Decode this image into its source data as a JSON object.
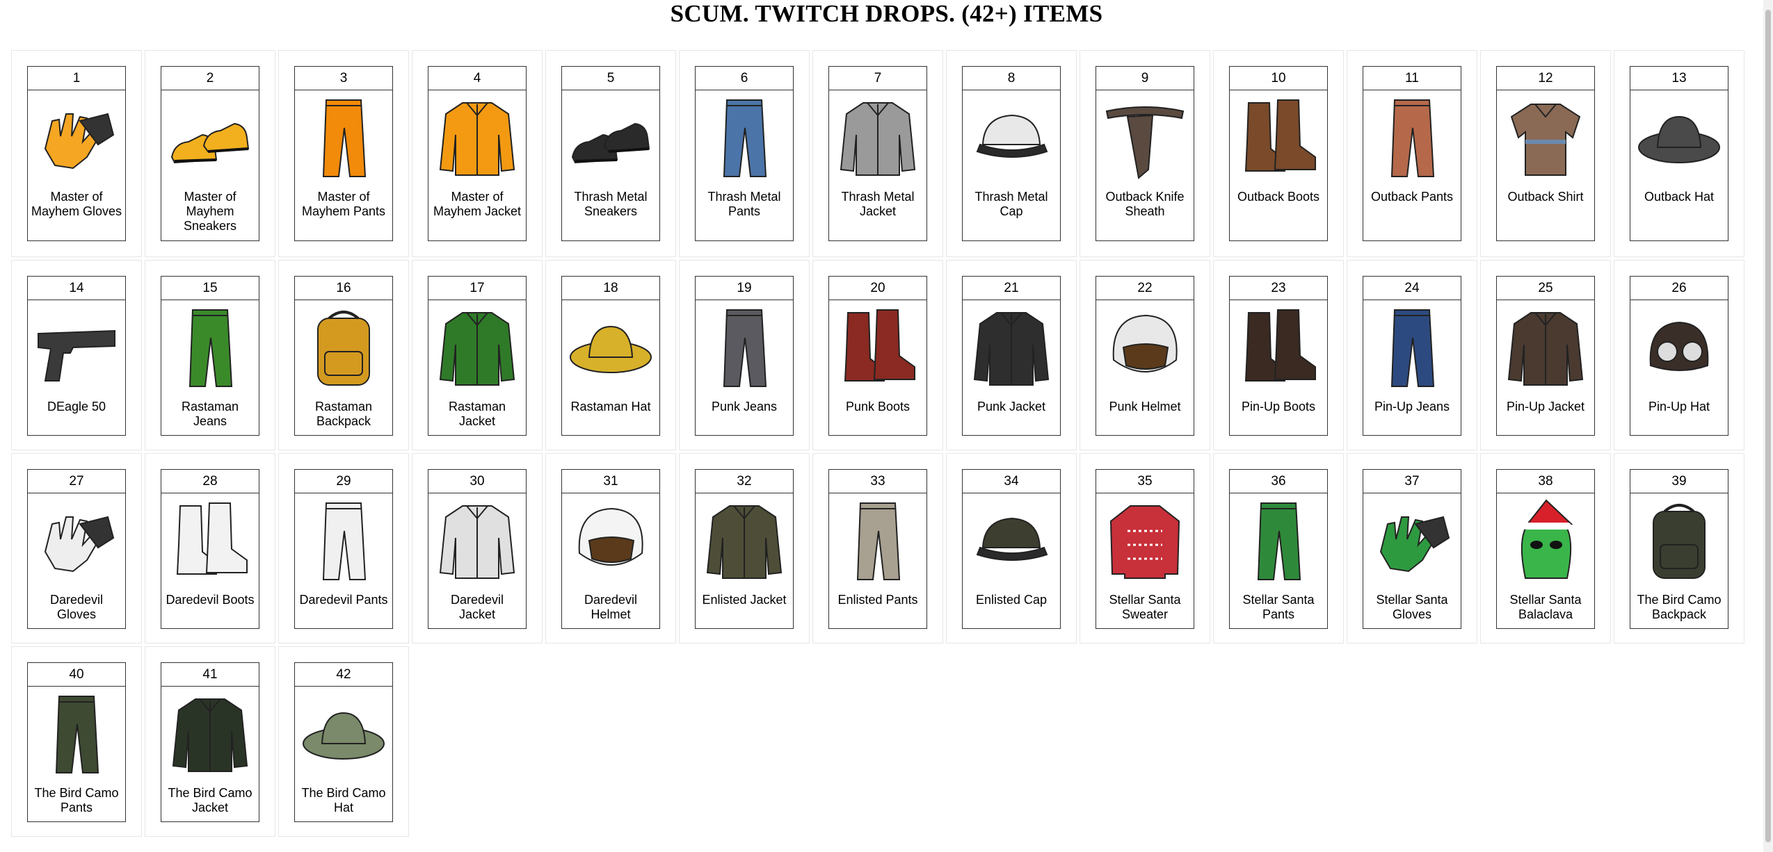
{
  "page": {
    "title": "SCUM. TWITCH DROPS. (42+) ITEMS"
  },
  "items": [
    {
      "num": "1",
      "label": "Master of Mayhem Gloves",
      "icon": "gloves-icon",
      "color": "#f5a623"
    },
    {
      "num": "2",
      "label": "Master of Mayhem Sneakers",
      "icon": "sneakers-icon",
      "color": "#f2b01e"
    },
    {
      "num": "3",
      "label": "Master of Mayhem Pants",
      "icon": "pants-icon",
      "color": "#f28a0a"
    },
    {
      "num": "4",
      "label": "Master of Mayhem Jacket",
      "icon": "jacket-icon",
      "color": "#f39a12"
    },
    {
      "num": "5",
      "label": "Thrash Metal Sneakers",
      "icon": "sneakers-icon",
      "color": "#2a2a2a"
    },
    {
      "num": "6",
      "label": "Thrash Metal Pants",
      "icon": "pants-icon",
      "color": "#4b74a8"
    },
    {
      "num": "7",
      "label": "Thrash Metal Jacket",
      "icon": "jacket-icon",
      "color": "#9a9a9a"
    },
    {
      "num": "8",
      "label": "Thrash Metal Cap",
      "icon": "cap-icon",
      "color": "#e8e8e8"
    },
    {
      "num": "9",
      "label": "Outback Knife Sheath",
      "icon": "sheath-icon",
      "color": "#5a4a40"
    },
    {
      "num": "10",
      "label": "Outback Boots",
      "icon": "boots-icon",
      "color": "#7a4a2a"
    },
    {
      "num": "11",
      "label": "Outback Pants",
      "icon": "pants-icon",
      "color": "#b5694a"
    },
    {
      "num": "12",
      "label": "Outback Shirt",
      "icon": "shirt-icon",
      "color": "#8a6a55"
    },
    {
      "num": "13",
      "label": "Outback Hat",
      "icon": "hat-icon",
      "color": "#4a4a4a"
    },
    {
      "num": "14",
      "label": "DEagle 50",
      "icon": "pistol-icon",
      "color": "#3a3a3a"
    },
    {
      "num": "15",
      "label": "Rastaman Jeans",
      "icon": "pants-icon",
      "color": "#3a8a2a"
    },
    {
      "num": "16",
      "label": "Rastaman Backpack",
      "icon": "backpack-icon",
      "color": "#d49a20"
    },
    {
      "num": "17",
      "label": "Rastaman Jacket",
      "icon": "jacket-icon",
      "color": "#2f7a28"
    },
    {
      "num": "18",
      "label": "Rastaman Hat",
      "icon": "hat-icon",
      "color": "#d8b12a"
    },
    {
      "num": "19",
      "label": "Punk Jeans",
      "icon": "pants-icon",
      "color": "#5a5a60"
    },
    {
      "num": "20",
      "label": "Punk Boots",
      "icon": "boots-icon",
      "color": "#8a2a22"
    },
    {
      "num": "21",
      "label": "Punk Jacket",
      "icon": "jacket-icon",
      "color": "#2e2e2e"
    },
    {
      "num": "22",
      "label": "Punk Helmet",
      "icon": "helmet-icon",
      "color": "#e8e8e8"
    },
    {
      "num": "23",
      "label": "Pin-Up Boots",
      "icon": "boots-icon",
      "color": "#3a2a22"
    },
    {
      "num": "24",
      "label": "Pin-Up Jeans",
      "icon": "pants-icon",
      "color": "#2d4a80"
    },
    {
      "num": "25",
      "label": "Pin-Up Jacket",
      "icon": "jacket-icon",
      "color": "#4a3a30"
    },
    {
      "num": "26",
      "label": "Pin-Up Hat",
      "icon": "aviator-hat-icon",
      "color": "#3a2e28"
    },
    {
      "num": "27",
      "label": "Daredevil Gloves",
      "icon": "gloves-icon",
      "color": "#eeeeee"
    },
    {
      "num": "28",
      "label": "Daredevil Boots",
      "icon": "boots-icon",
      "color": "#f2f2f2"
    },
    {
      "num": "29",
      "label": "Daredevil Pants",
      "icon": "pants-icon",
      "color": "#f0f0f0"
    },
    {
      "num": "30",
      "label": "Daredevil Jacket",
      "icon": "jacket-icon",
      "color": "#e0e0e0"
    },
    {
      "num": "31",
      "label": "Daredevil Helmet",
      "icon": "helmet-icon",
      "color": "#f4f4f4"
    },
    {
      "num": "32",
      "label": "Enlisted Jacket",
      "icon": "jacket-icon",
      "color": "#4e4e38"
    },
    {
      "num": "33",
      "label": "Enlisted Pants",
      "icon": "pants-icon",
      "color": "#a8a090"
    },
    {
      "num": "34",
      "label": "Enlisted Cap",
      "icon": "cap-icon",
      "color": "#3e3e30"
    },
    {
      "num": "35",
      "label": "Stellar Santa Sweater",
      "icon": "sweater-icon",
      "color": "#c8303a"
    },
    {
      "num": "36",
      "label": "Stellar Santa Pants",
      "icon": "pants-icon",
      "color": "#2e8a3a"
    },
    {
      "num": "37",
      "label": "Stellar Santa Gloves",
      "icon": "gloves-icon",
      "color": "#2e9a40"
    },
    {
      "num": "38",
      "label": "Stellar Santa Balaclava",
      "icon": "balaclava-icon",
      "color": "#3ab54a"
    },
    {
      "num": "39",
      "label": "The Bird Camo Backpack",
      "icon": "backpack-icon",
      "color": "#3a3e30"
    },
    {
      "num": "40",
      "label": "The Bird Camo Pants",
      "icon": "pants-icon",
      "color": "#3e4a32"
    },
    {
      "num": "41",
      "label": "The Bird Camo Jacket",
      "icon": "jacket-icon",
      "color": "#2a3426"
    },
    {
      "num": "42",
      "label": "The Bird Camo Hat",
      "icon": "hat-icon",
      "color": "#7a8a6a"
    }
  ]
}
